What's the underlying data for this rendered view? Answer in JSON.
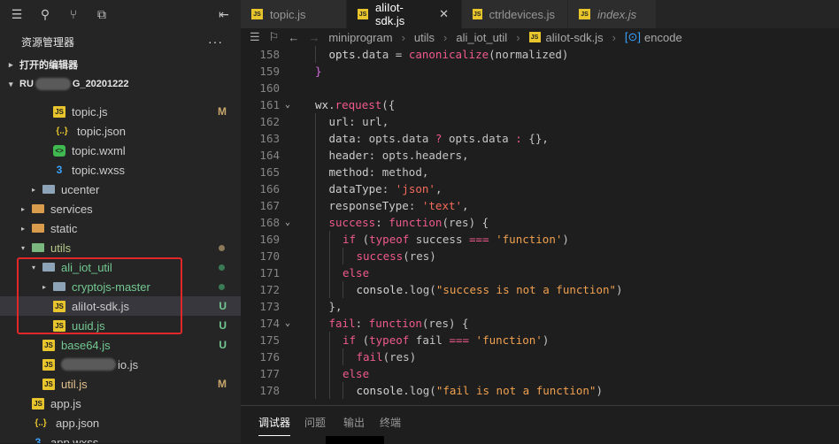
{
  "sidebar": {
    "toolbar_icons": [
      "list-icon",
      "search-icon",
      "branch-icon",
      "extensions-icon",
      "collapse-icon"
    ],
    "explorer_title": "资源管理器",
    "more_label": "···",
    "open_editors_label": "打开的编辑器",
    "project_label_start": "RU",
    "project_label_end": "G_20201222",
    "tree": [
      {
        "name": "topic.js",
        "type": "js",
        "indent": 3,
        "badge": "M",
        "badge_color": "#c8a66b"
      },
      {
        "name": "topic.json",
        "type": "json",
        "indent": 3
      },
      {
        "name": "topic.wxml",
        "type": "wxml",
        "indent": 3
      },
      {
        "name": "topic.wxss",
        "type": "wxss",
        "indent": 3
      },
      {
        "name": "ucenter",
        "type": "folder",
        "indent": 2,
        "twisty": "›"
      },
      {
        "name": "services",
        "type": "folder-orange",
        "indent": 1,
        "twisty": "›"
      },
      {
        "name": "static",
        "type": "folder-orange",
        "indent": 1,
        "twisty": "›"
      },
      {
        "name": "utils",
        "type": "folder-green",
        "indent": 1,
        "twisty": "⌄",
        "dot": "#8c7a5a",
        "name_color": "#b7c98a"
      },
      {
        "name": "ali_iot_util",
        "type": "folder",
        "indent": 2,
        "twisty": "⌄",
        "dot": "#3a7a55",
        "name_color": "#73c991"
      },
      {
        "name": "cryptojs-master",
        "type": "folder",
        "indent": 3,
        "twisty": "›",
        "dot": "#3a7a55",
        "name_color": "#73c991"
      },
      {
        "name": "aliIot-sdk.js",
        "type": "js",
        "indent": 3,
        "badge": "U",
        "badge_color": "#73c991",
        "selected": true
      },
      {
        "name": "uuid.js",
        "type": "js",
        "indent": 3,
        "badge": "U",
        "badge_color": "#73c991",
        "name_color": "#73c991"
      },
      {
        "name": "base64.js",
        "type": "js",
        "indent": 2,
        "badge": "U",
        "badge_color": "#73c991",
        "name_color": "#73c991"
      },
      {
        "name": "io.js",
        "type": "js",
        "indent": 2,
        "blurred": true
      },
      {
        "name": "util.js",
        "type": "js",
        "indent": 2,
        "badge": "M",
        "badge_color": "#c8a66b",
        "name_color": "#e2c08d"
      },
      {
        "name": "app.js",
        "type": "js",
        "indent": 1
      },
      {
        "name": "app.json",
        "type": "json",
        "indent": 1
      },
      {
        "name": "app.wxss",
        "type": "wxss",
        "indent": 1
      }
    ]
  },
  "tabs": [
    {
      "label": "topic.js",
      "active": false,
      "italic": false
    },
    {
      "label": "aliIot-sdk.js",
      "active": true,
      "italic": false,
      "close": "✕"
    },
    {
      "label": "ctrldevices.js",
      "active": false,
      "italic": false
    },
    {
      "label": "index.js",
      "active": false,
      "italic": true
    }
  ],
  "breadcrumb": [
    "miniprogram",
    "utils",
    "ali_iot_util",
    "aliIot-sdk.js",
    "encode"
  ],
  "breadcrumb_symbol": "[⊙]",
  "code_lines": [
    {
      "n": "158",
      "fold": "",
      "indent": 1,
      "tokens": [
        [
          "opts",
          "var"
        ],
        [
          ".data = ",
          "punc"
        ],
        [
          "canonicalize",
          "fn"
        ],
        [
          "(normalized)",
          "punc"
        ]
      ]
    },
    {
      "n": "159",
      "fold": "",
      "indent": 0,
      "tokens": [
        [
          "}",
          "brace"
        ]
      ]
    },
    {
      "n": "160",
      "fold": "",
      "indent": 0,
      "tokens": []
    },
    {
      "n": "161",
      "fold": "⌄",
      "indent": 0,
      "tokens": [
        [
          "wx",
          "var"
        ],
        [
          ".",
          "punc"
        ],
        [
          "request",
          "fn"
        ],
        [
          "({",
          "punc"
        ]
      ]
    },
    {
      "n": "162",
      "fold": "",
      "indent": 1,
      "tokens": [
        [
          "url",
          "prop"
        ],
        [
          ": url,",
          "punc"
        ]
      ]
    },
    {
      "n": "163",
      "fold": "",
      "indent": 1,
      "tokens": [
        [
          "data",
          "prop"
        ],
        [
          ": opts.data ",
          "punc"
        ],
        [
          "?",
          "kw"
        ],
        [
          " opts.data ",
          "punc"
        ],
        [
          ":",
          "kw"
        ],
        [
          " {},",
          "punc"
        ]
      ]
    },
    {
      "n": "164",
      "fold": "",
      "indent": 1,
      "tokens": [
        [
          "header",
          "prop"
        ],
        [
          ": opts.headers,",
          "punc"
        ]
      ]
    },
    {
      "n": "165",
      "fold": "",
      "indent": 1,
      "tokens": [
        [
          "method",
          "prop"
        ],
        [
          ": method,",
          "punc"
        ]
      ]
    },
    {
      "n": "166",
      "fold": "",
      "indent": 1,
      "tokens": [
        [
          "dataType",
          "prop"
        ],
        [
          ": ",
          "punc"
        ],
        [
          "'json'",
          "str2"
        ],
        [
          ",",
          "punc"
        ]
      ]
    },
    {
      "n": "167",
      "fold": "",
      "indent": 1,
      "tokens": [
        [
          "responseType",
          "prop"
        ],
        [
          ": ",
          "punc"
        ],
        [
          "'text'",
          "str2"
        ],
        [
          ",",
          "punc"
        ]
      ]
    },
    {
      "n": "168",
      "fold": "⌄",
      "indent": 1,
      "tokens": [
        [
          "success",
          "fn"
        ],
        [
          ": ",
          "punc"
        ],
        [
          "function",
          "kw"
        ],
        [
          "(res) {",
          "punc"
        ]
      ]
    },
    {
      "n": "169",
      "fold": "",
      "indent": 2,
      "tokens": [
        [
          "if",
          "kw"
        ],
        [
          " (",
          "punc"
        ],
        [
          "typeof",
          "kw"
        ],
        [
          " success ",
          "punc"
        ],
        [
          "===",
          "kw"
        ],
        [
          " ",
          "punc"
        ],
        [
          "'function'",
          "str"
        ],
        [
          ")",
          "punc"
        ]
      ]
    },
    {
      "n": "170",
      "fold": "",
      "indent": 3,
      "tokens": [
        [
          "success",
          "fn"
        ],
        [
          "(res)",
          "punc"
        ]
      ]
    },
    {
      "n": "171",
      "fold": "",
      "indent": 2,
      "tokens": [
        [
          "else",
          "kw"
        ]
      ]
    },
    {
      "n": "172",
      "fold": "",
      "indent": 3,
      "tokens": [
        [
          "console",
          "var"
        ],
        [
          ".log(",
          "punc"
        ],
        [
          "\"success is not a function\"",
          "str"
        ],
        [
          ")",
          "punc"
        ]
      ]
    },
    {
      "n": "173",
      "fold": "",
      "indent": 1,
      "tokens": [
        [
          "},",
          "punc"
        ]
      ]
    },
    {
      "n": "174",
      "fold": "⌄",
      "indent": 1,
      "tokens": [
        [
          "fail",
          "fn"
        ],
        [
          ": ",
          "punc"
        ],
        [
          "function",
          "kw"
        ],
        [
          "(res) {",
          "punc"
        ]
      ]
    },
    {
      "n": "175",
      "fold": "",
      "indent": 2,
      "tokens": [
        [
          "if",
          "kw"
        ],
        [
          " (",
          "punc"
        ],
        [
          "typeof",
          "kw"
        ],
        [
          " fail ",
          "punc"
        ],
        [
          "===",
          "kw"
        ],
        [
          " ",
          "punc"
        ],
        [
          "'function'",
          "str"
        ],
        [
          ")",
          "punc"
        ]
      ]
    },
    {
      "n": "176",
      "fold": "",
      "indent": 3,
      "tokens": [
        [
          "fail",
          "fn"
        ],
        [
          "(res)",
          "punc"
        ]
      ]
    },
    {
      "n": "177",
      "fold": "",
      "indent": 2,
      "tokens": [
        [
          "else",
          "kw"
        ]
      ]
    },
    {
      "n": "178",
      "fold": "",
      "indent": 3,
      "tokens": [
        [
          "console",
          "var"
        ],
        [
          ".log(",
          "punc"
        ],
        [
          "\"fail is not a function\"",
          "str"
        ],
        [
          ")",
          "punc"
        ]
      ]
    }
  ],
  "panel_tabs": [
    "调试器",
    "问题",
    "输出",
    "终端"
  ]
}
